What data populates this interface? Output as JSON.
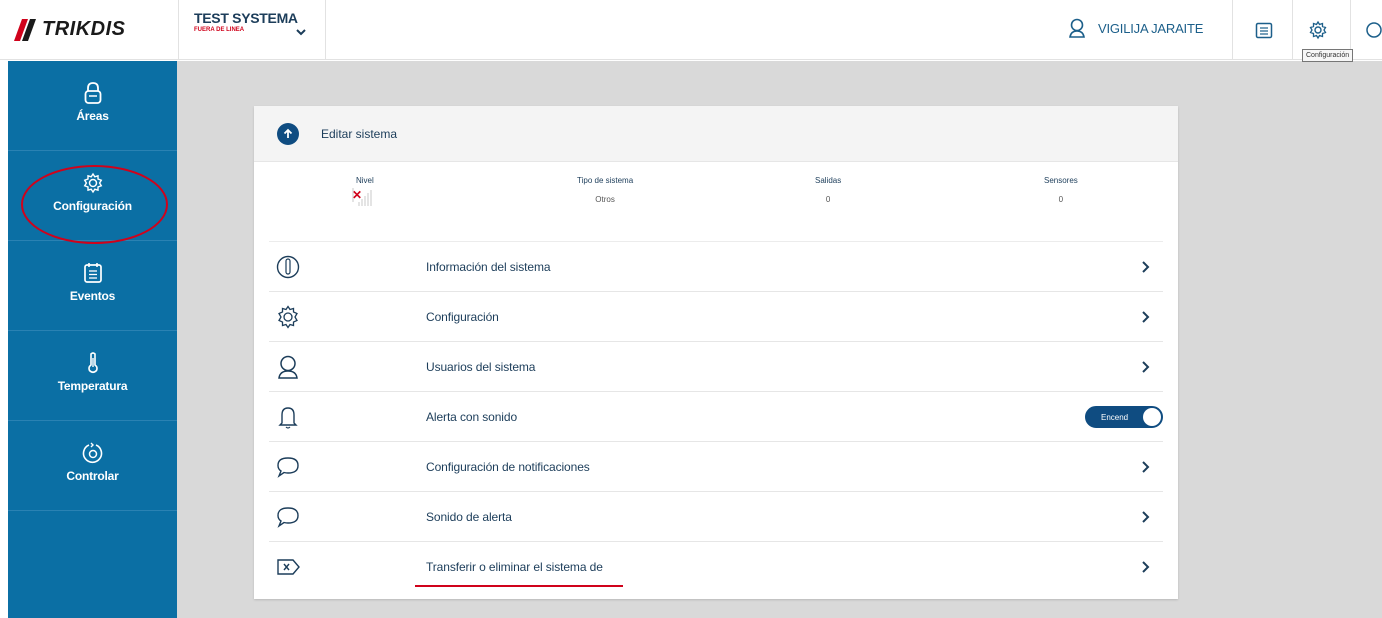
{
  "brand": {
    "logo_text": "TRIKDIS"
  },
  "system": {
    "name": "TEST SYSTEMA",
    "status": "FUERA DE LINEA"
  },
  "user": {
    "name": "VIGILIJA JARAITE"
  },
  "tooltip": {
    "text": "Configuración"
  },
  "sidebar": {
    "items": [
      {
        "label": "Áreas",
        "icon": "lock-icon"
      },
      {
        "label": "Configuración",
        "icon": "gear-icon"
      },
      {
        "label": "Eventos",
        "icon": "calendar-icon"
      },
      {
        "label": "Temperatura",
        "icon": "thermometer-icon"
      },
      {
        "label": "Controlar",
        "icon": "control-icon"
      }
    ]
  },
  "card": {
    "title": "Editar sistema",
    "stats": {
      "nivel": {
        "label": "Nivel"
      },
      "tipo": {
        "label": "Tipo de sistema",
        "value": "Otros"
      },
      "salidas": {
        "label": "Salidas",
        "value": "0"
      },
      "sensores": {
        "label": "Sensores",
        "value": "0"
      }
    },
    "rows": [
      {
        "label": "Información del sistema",
        "icon": "info-icon"
      },
      {
        "label": "Configuración",
        "icon": "gear-icon"
      },
      {
        "label": "Usuarios del sistema",
        "icon": "user-icon"
      },
      {
        "label": "Alerta con sonido",
        "icon": "bell-icon",
        "toggle_label": "Encend"
      },
      {
        "label": "Configuración de notificaciones",
        "icon": "speech-bubble-icon"
      },
      {
        "label": "Sonido de alerta",
        "icon": "speech-bubble-icon"
      },
      {
        "label": "Transferir o eliminar el sistema de",
        "icon": "delete-tag-icon"
      }
    ]
  },
  "colors": {
    "sidebar": "#0b6fa4",
    "accent": "#0f4c81",
    "annotation": "#d0021b",
    "background": "#d9d9d9"
  }
}
